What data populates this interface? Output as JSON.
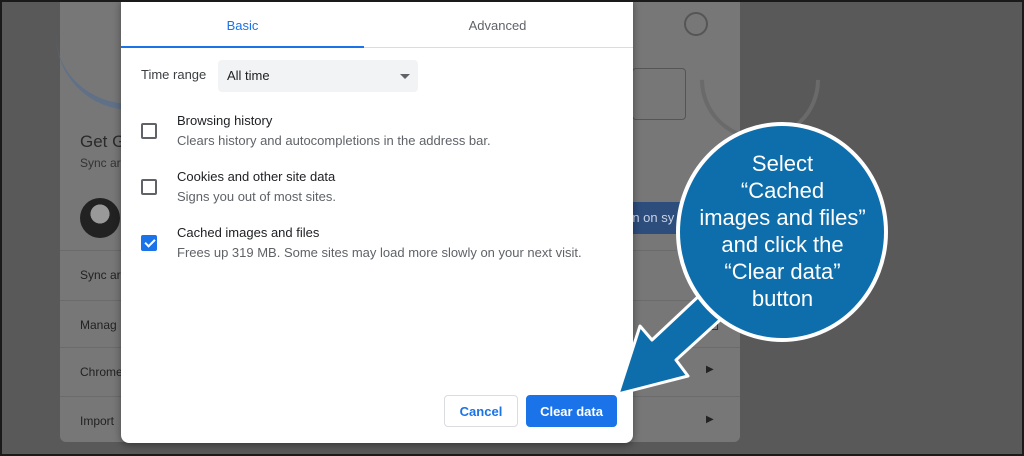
{
  "dialog": {
    "tabs": {
      "basic": "Basic",
      "advanced": "Advanced"
    },
    "time_range": {
      "label": "Time range",
      "value": "All time"
    },
    "options": [
      {
        "title": "Browsing history",
        "description": "Clears history and autocompletions in the address bar.",
        "checked": false
      },
      {
        "title": "Cookies and other site data",
        "description": "Signs you out of most sites.",
        "checked": false
      },
      {
        "title": "Cached images and files",
        "description": "Frees up 319 MB. Some sites may load more slowly on your next visit.",
        "checked": true
      }
    ],
    "buttons": {
      "cancel": "Cancel",
      "clear": "Clear data"
    }
  },
  "background": {
    "title": "Get G",
    "subtitle": "Sync ar",
    "turn_on": "rn on sy",
    "rows": [
      "Sync ar",
      "Manag",
      "Chrome",
      "Import"
    ]
  },
  "callout": {
    "lines": [
      "Select",
      "“Cached",
      "images and files”",
      "and click the",
      "“Clear data”",
      "button"
    ],
    "fill_color": "#0e6eab",
    "border_color": "#ffffff"
  },
  "colors": {
    "accent": "#1a73e8"
  }
}
